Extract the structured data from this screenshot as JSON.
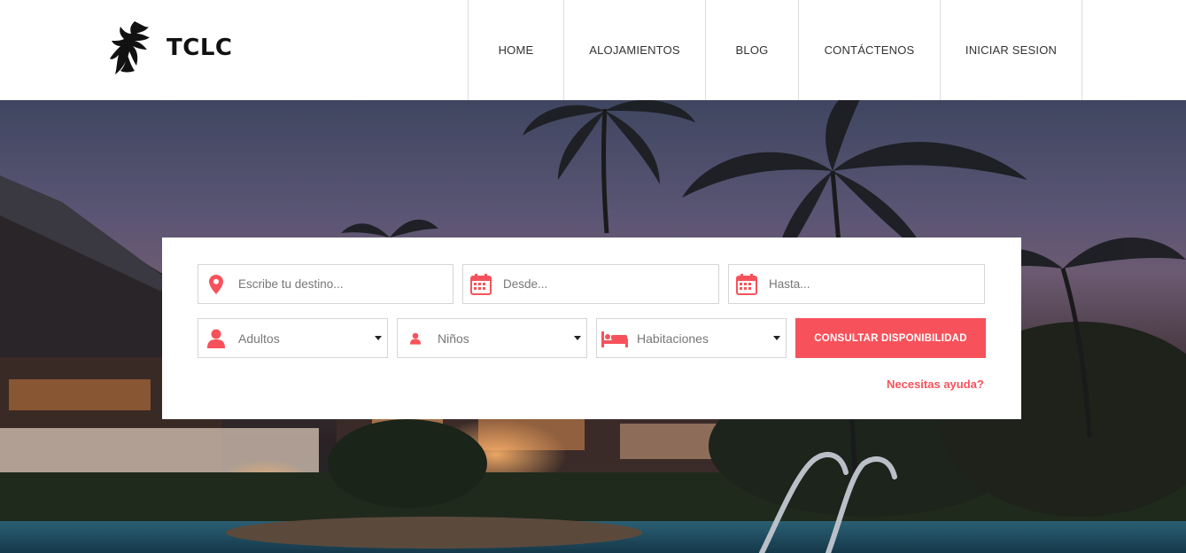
{
  "brand": {
    "name": "TCLC",
    "logo_icon": "flame-leaf-logo"
  },
  "nav": {
    "items": [
      {
        "label": "HOME"
      },
      {
        "label": "ALOJAMIENTOS"
      },
      {
        "label": "BLOG"
      },
      {
        "label": "CONTÁCTENOS"
      },
      {
        "label": "INICIAR SESION"
      }
    ]
  },
  "search": {
    "destination_placeholder": "Escribe tu destino...",
    "from_placeholder": "Desde...",
    "to_placeholder": "Hasta...",
    "adults_label": "Adultos",
    "children_label": "Niños",
    "rooms_label": "Habitaciones",
    "submit_label": "CONSULTAR DISPONIBILIDAD",
    "help_label": "Necesitas ayuda?"
  },
  "colors": {
    "accent": "#f7525b",
    "border": "#d6d6d6",
    "text": "#333333"
  }
}
